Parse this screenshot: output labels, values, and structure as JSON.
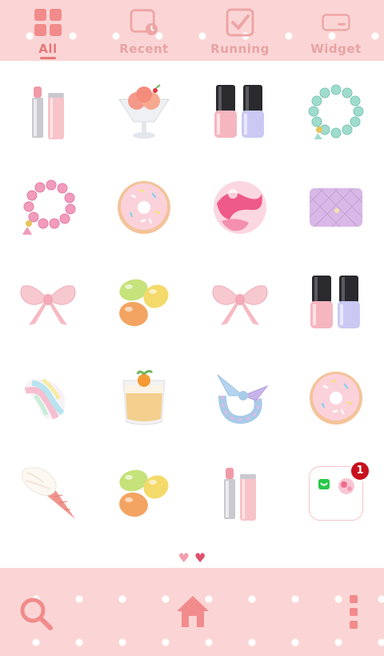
{
  "tabs": [
    {
      "label": "All",
      "icon": "grid-icon",
      "active": true
    },
    {
      "label": "Recent",
      "icon": "clock-icon",
      "active": false
    },
    {
      "label": "Running",
      "icon": "checkbox-icon",
      "active": false
    },
    {
      "label": "Widget",
      "icon": "widget-icon",
      "active": false
    }
  ],
  "apps": [
    [
      "lipstick-icon",
      "ice-cream-sundae-icon",
      "nail-polish-icon",
      "bead-bracelet-icon"
    ],
    [
      "pink-bracelet-icon",
      "donut-icon",
      "swirl-candy-icon",
      "purse-icon"
    ],
    [
      "ribbon-bow-icon",
      "jelly-beans-icon",
      "ribbon-bow-icon",
      "nail-polish-icon"
    ],
    [
      "marshmallow-icon",
      "pudding-cup-icon",
      "hair-scarf-icon",
      "donut-icon"
    ],
    [
      "soft-serve-cone-icon",
      "jelly-beans-icon",
      "lipstick-icon",
      "folder-icon"
    ]
  ],
  "folder": {
    "badge_count": "1"
  },
  "page_indicator": {
    "symbol_inactive": "♥",
    "symbol_active": "♥",
    "current_page": 2,
    "page_count": 2
  },
  "dock": {
    "left": "search-icon",
    "center": "home-icon",
    "right": "menu-dots-icon"
  },
  "colors": {
    "accent": "#e57878",
    "tab_inactive": "#e8a3a3",
    "bar_bg": "#fbd5d5",
    "badge": "#c8101e"
  }
}
